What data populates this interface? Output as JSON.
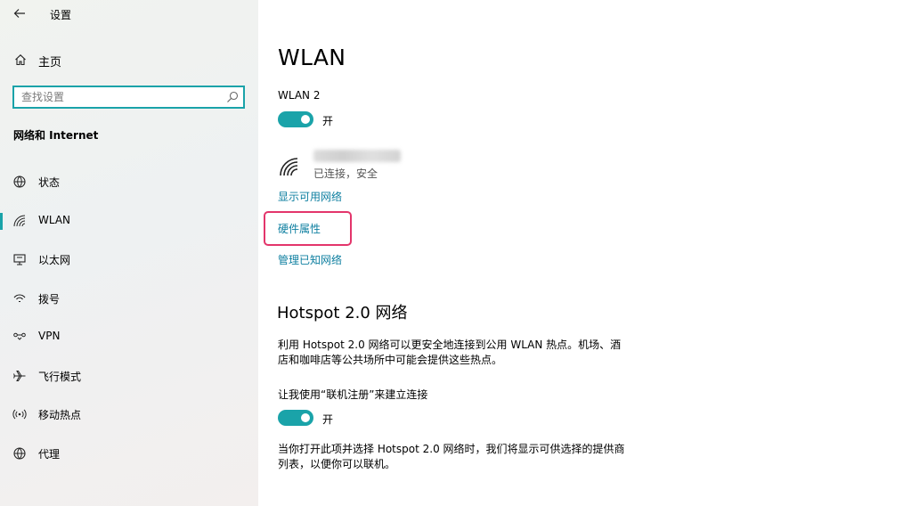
{
  "app": {
    "title": "设置"
  },
  "sidebar": {
    "home_label": "主页",
    "search_placeholder": "查找设置",
    "section_heading": "网络和 Internet",
    "items": [
      {
        "label": "状态",
        "icon": "globe-status-icon",
        "selected": false
      },
      {
        "label": "WLAN",
        "icon": "wifi-icon",
        "selected": true
      },
      {
        "label": "以太网",
        "icon": "ethernet-icon",
        "selected": false
      },
      {
        "label": "拨号",
        "icon": "dialup-icon",
        "selected": false
      },
      {
        "label": "VPN",
        "icon": "vpn-icon",
        "selected": false
      },
      {
        "label": "飞行模式",
        "icon": "airplane-icon",
        "selected": false
      },
      {
        "label": "移动热点",
        "icon": "hotspot-icon",
        "selected": false
      },
      {
        "label": "代理",
        "icon": "globe-proxy-icon",
        "selected": false
      }
    ]
  },
  "main": {
    "title": "WLAN",
    "adapter_name": "WLAN 2",
    "wlan_toggle": {
      "state_label": "开",
      "on": true
    },
    "network": {
      "status": "已连接，安全"
    },
    "links": {
      "show_available": "显示可用网络",
      "hardware_properties": "硬件属性",
      "manage_known": "管理已知网络"
    },
    "hotspot": {
      "heading": "Hotspot 2.0 网络",
      "description_line1": "利用 Hotspot 2.0 网络可以更安全地连接到公用 WLAN 热点。机场、酒",
      "description_line2": "店和咖啡店等公共场所中可能会提供这些热点。",
      "toggle_label": "让我使用“联机注册”来建立连接",
      "toggle": {
        "state_label": "开",
        "on": true
      },
      "note_line1": "当你打开此项并选择 Hotspot 2.0 网络时，我们将显示可供选择的提供商",
      "note_line2": "列表，以便你可以联机。"
    }
  },
  "colors": {
    "accent": "#1aa3a9",
    "link": "#0e7fa0",
    "highlight": "#e3356b"
  }
}
